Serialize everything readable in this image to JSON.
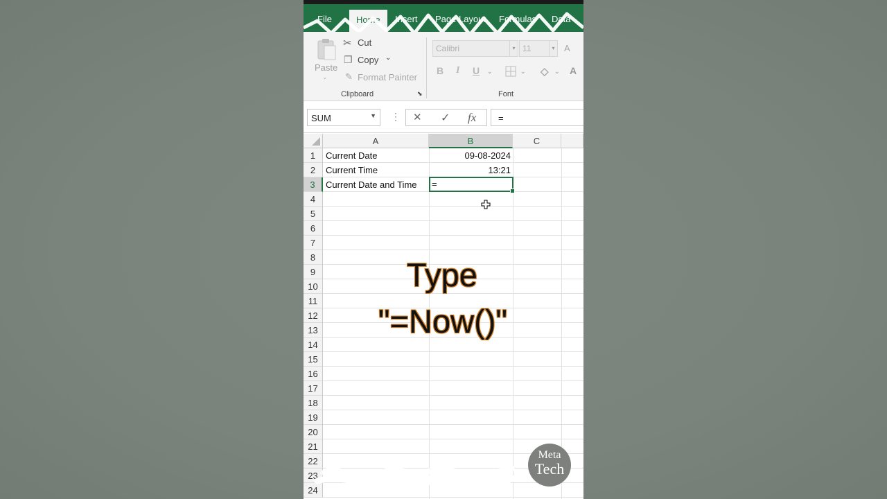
{
  "ribbon": {
    "tabs": [
      "File",
      "Home",
      "Insert",
      "Page Layout",
      "Formulas",
      "Data"
    ],
    "active_tab": "Home",
    "clipboard": {
      "paste_label": "Paste",
      "cut_label": "Cut",
      "copy_label": "Copy",
      "format_painter_label": "Format Painter",
      "group_label": "Clipboard"
    },
    "font": {
      "font_name": "Calibri",
      "font_size": "11",
      "group_label": "Font",
      "bold": "B",
      "italic": "I",
      "underline": "U",
      "font_color": "A",
      "grow_font": "A"
    }
  },
  "formula_bar": {
    "name_box": "SUM",
    "cancel_glyph": "✕",
    "enter_glyph": "✓",
    "fx_label": "fx",
    "content": "="
  },
  "sheet": {
    "columns": [
      "A",
      "B",
      "C",
      ""
    ],
    "selected_column": "B",
    "rows": [
      "1",
      "2",
      "3",
      "4",
      "5",
      "6",
      "7",
      "8",
      "9",
      "10",
      "11",
      "12",
      "13",
      "14",
      "15",
      "16",
      "17",
      "18",
      "19",
      "20",
      "21",
      "22",
      "23",
      "24"
    ],
    "selected_row": "3",
    "cells": {
      "A1": "Current Date",
      "B1": "09-08-2024",
      "A2": "Current Time",
      "B2": "13:21",
      "A3": "Current Date and Time",
      "B3": "="
    }
  },
  "overlay": {
    "line1": "Type",
    "line2": "\"=Now()\""
  },
  "watermark": {
    "line1": "Meta",
    "line2": "Tech"
  },
  "colors": {
    "excel_green": "#217346",
    "background": "#7a847c"
  }
}
